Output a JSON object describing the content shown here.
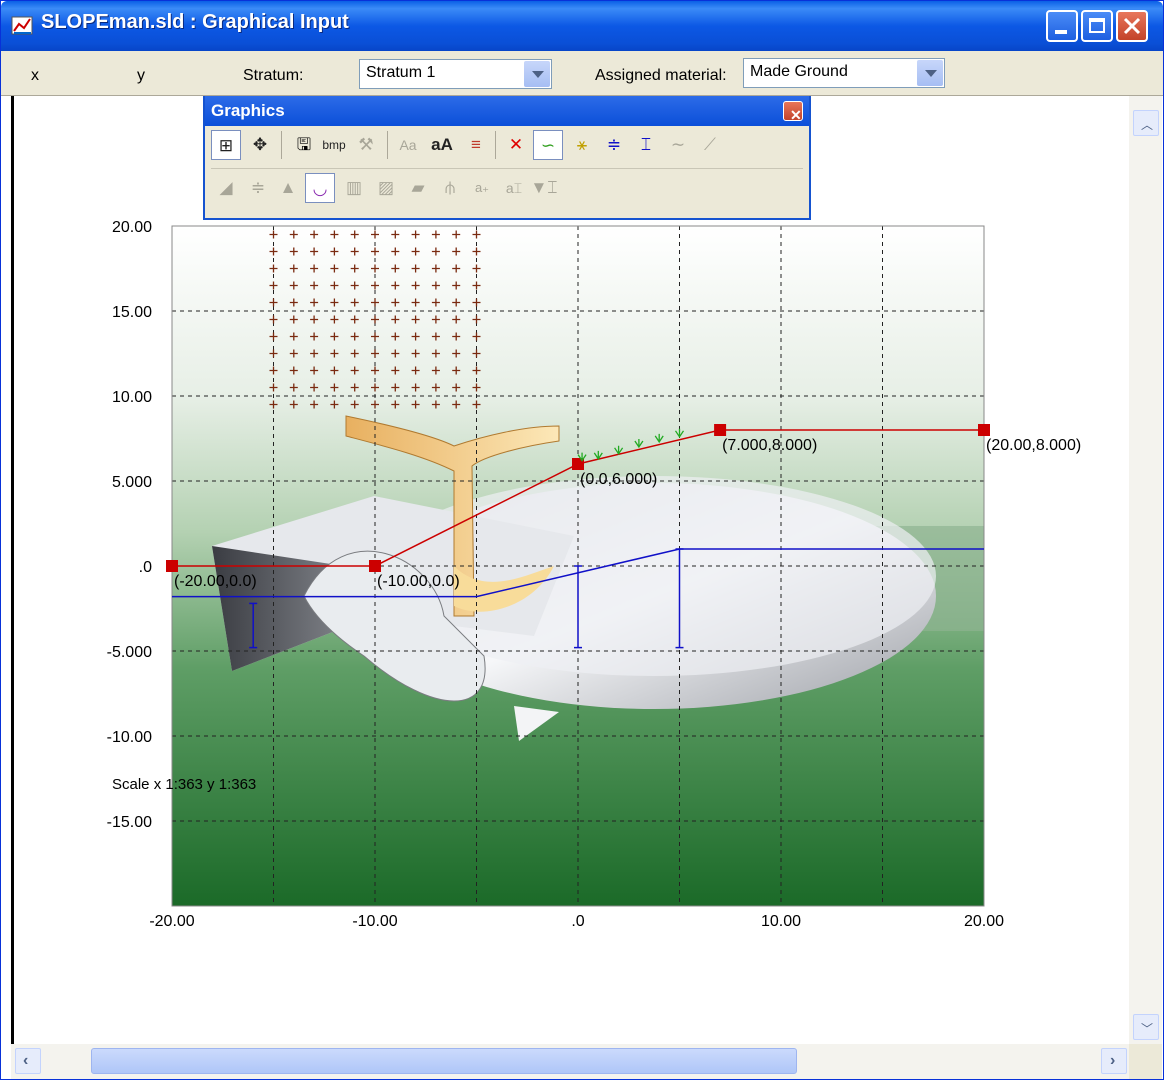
{
  "window": {
    "title": "SLOPEman.sld : Graphical Input"
  },
  "toolbar": {
    "x_label": "x",
    "y_label": "y",
    "stratum_label": "Stratum:",
    "stratum_value": "Stratum 1",
    "material_label": "Assigned material:",
    "material_value": "Made Ground"
  },
  "graphics_palette": {
    "title": "Graphics",
    "row1_icons": [
      "grid-icon",
      "move-icon",
      "save-icon",
      "bmp-export-icon",
      "tools-icon",
      "font-icon",
      "bold-font-icon",
      "line-colors-icon",
      "delete-icon",
      "stratum-line-icon",
      "water-table-icon",
      "water-level-icon",
      "pile-icon",
      "curve-icon",
      "slope-icon"
    ],
    "bmp_text": "bmp",
    "row2_icons": [
      "surface-icon",
      "level-icon",
      "load-icon",
      "slip-circle-icon",
      "column-icon",
      "hatch-icon",
      "fill-icon",
      "anchor-icon",
      "add-label-icon",
      "text-label-icon",
      "text-bottom-icon"
    ]
  },
  "plot": {
    "y_ticks": [
      "20.00",
      "15.00",
      "10.00",
      "5.000",
      ".0",
      "-5.000",
      "-10.00",
      "-15.00"
    ],
    "x_ticks": [
      "-20.00",
      "-10.00",
      ".0",
      "10.00",
      "20.00"
    ],
    "scale_text": "Scale x 1:363  y 1:363",
    "surface_points": [
      {
        "x": -20,
        "y": 0,
        "label": "(-20.00,0.0)"
      },
      {
        "x": -10,
        "y": 0,
        "label": "(-10.00,0.0)"
      },
      {
        "x": 0,
        "y": 6,
        "label": "(0.0,6.000)"
      },
      {
        "x": 7,
        "y": 8,
        "label": "(7.000,8.000)"
      },
      {
        "x": 20,
        "y": 8,
        "label": "(20.00,8.000)"
      }
    ],
    "colors": {
      "surface_line": "#CC0000",
      "water_line": "#1010C8",
      "grid_bg_top": "#FFFFFF",
      "grid_bg_bottom": "#1E6E2A",
      "search_grid": "#7A2A10"
    }
  }
}
